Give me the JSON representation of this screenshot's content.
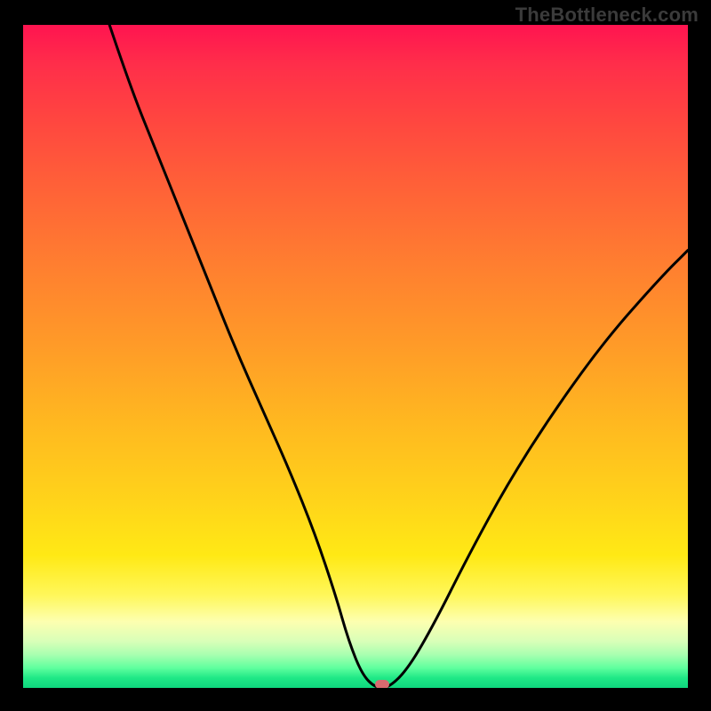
{
  "watermark": "TheBottleneck.com",
  "colors": {
    "frame": "#000000",
    "curve": "#000000",
    "marker": "#d86a6f",
    "gradient_top": "#ff1450",
    "gradient_bottom": "#0fd77e"
  },
  "chart_data": {
    "type": "line",
    "title": "",
    "xlabel": "",
    "ylabel": "",
    "xlim": [
      0,
      100
    ],
    "ylim": [
      0,
      100
    ],
    "grid": false,
    "legend": false,
    "series": [
      {
        "name": "bottleneck-curve",
        "x": [
          13,
          16,
          20,
          24,
          28,
          32,
          36,
          40,
          44,
          47,
          49,
          51,
          53,
          55,
          58,
          62,
          67,
          73,
          80,
          88,
          96,
          100
        ],
        "y": [
          100,
          91,
          81,
          71,
          61,
          51,
          42,
          33,
          23,
          14,
          7,
          2,
          0,
          0,
          3,
          10,
          20,
          31,
          42,
          53,
          62,
          66
        ]
      }
    ],
    "annotations": [
      {
        "name": "minimum-marker",
        "x": 54,
        "y": 0
      }
    ],
    "background": {
      "type": "vertical-gradient",
      "meaning": "red=high bottleneck, green=low bottleneck",
      "stops": [
        {
          "pos": 0.0,
          "color": "#ff1450"
        },
        {
          "pos": 0.5,
          "color": "#ffb820"
        },
        {
          "pos": 0.86,
          "color": "#fff75a"
        },
        {
          "pos": 1.0,
          "color": "#0fd77e"
        }
      ]
    }
  }
}
